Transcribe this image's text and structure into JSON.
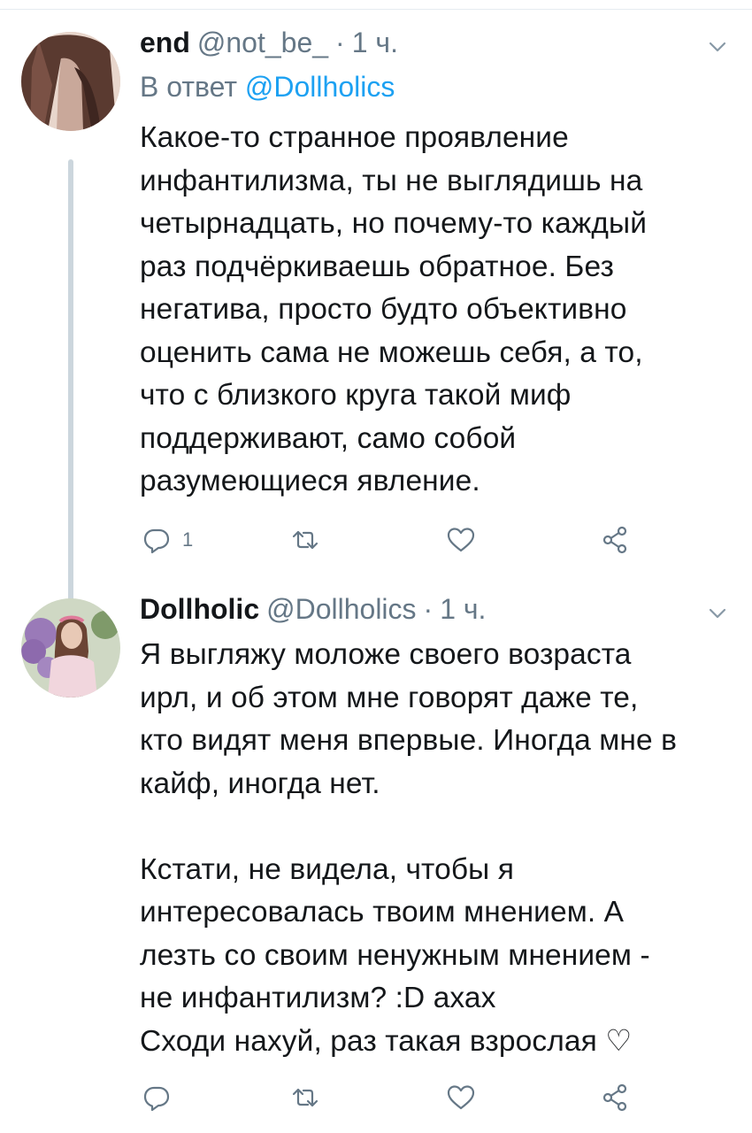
{
  "tweets": [
    {
      "name": "end",
      "handle": "@not_be_",
      "separator": "·",
      "time": "1 ч.",
      "reply_prefix": "В ответ",
      "reply_mention": "@Dollholics",
      "text": "Какое-то странное проявление\nинфантилизма, ты не выглядишь на\nчетырнадцать, но почему-то каждый\nраз подчёркиваешь обратное. Без\nнегатива, просто будто объективно\nоценить сама не можешь себя, а то,\nчто с близкого круга такой миф\nподдерживают, само собой\nразумеющиеся явление.",
      "reply_count": "1",
      "retweet_count": "",
      "like_count": ""
    },
    {
      "name": "Dollholic",
      "handle": "@Dollholics",
      "separator": "·",
      "time": "1 ч.",
      "text": "Я выгляжу моложе своего возраста\nирл, и об этом мне говорят даже те,\nкто видят меня впервые. Иногда мне в\nкайф, иногда нет.\n\nКстати, не видела, чтобы я\nинтересовалась твоим мнением. А\nлезть со своим ненужным мнением -\nне инфантилизм? :D ахах\nСходи нахуй, раз такая взрослая ♡",
      "reply_count": "",
      "retweet_count": "",
      "like_count": ""
    }
  ],
  "icons": {
    "reply": "reply-icon",
    "retweet": "retweet-icon",
    "like": "heart-icon",
    "share": "share-icon",
    "caret": "chevron-down-icon"
  },
  "colors": {
    "text": "#14171a",
    "secondary": "#657786",
    "link": "#1da1f2",
    "thread_line": "#ccd6dd"
  }
}
